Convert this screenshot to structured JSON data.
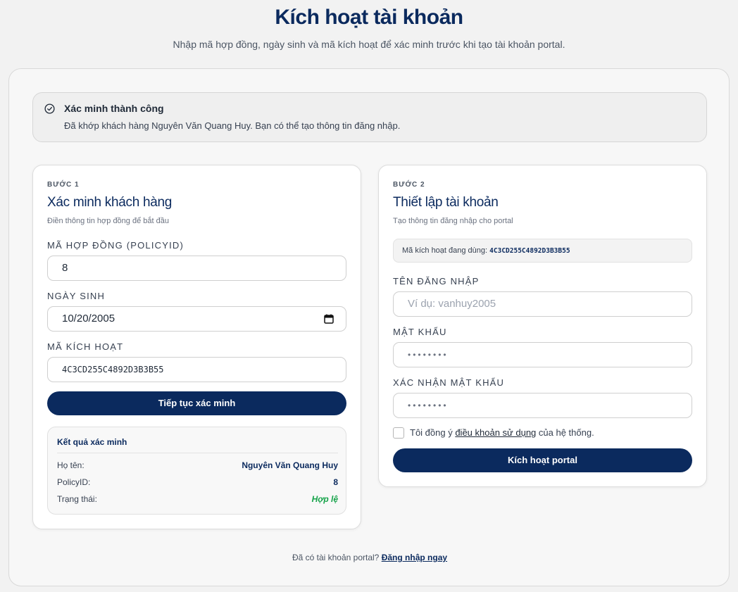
{
  "header": {
    "title": "Kích hoạt tài khoản",
    "subtitle": "Nhập mã hợp đồng, ngày sinh và mã kích hoạt để xác minh trước khi tạo tài khoản portal."
  },
  "alert": {
    "icon": "check-circle-icon",
    "title": "Xác minh thành công",
    "text": "Đã khớp khách hàng Nguyên Văn Quang Huy. Bạn có thể tạo thông tin đăng nhập."
  },
  "step1": {
    "label": "BƯỚC 1",
    "title": "Xác minh khách hàng",
    "description": "Điền thông tin hợp đồng để bắt đầu",
    "policy_label": "MÃ HỢP ĐỒNG (POLICYID)",
    "policy_value": "8",
    "dob_label": "NGÀY SINH",
    "dob_value": "10/20/2005",
    "code_label": "MÃ KÍCH HOẠT",
    "code_value": "4C3CD255C4892D3B3B55",
    "submit_label": "Tiếp tục xác minh",
    "result": {
      "title": "Kết quả xác minh",
      "rows": [
        {
          "key": "Họ tên:",
          "value": "Nguyên Văn Quang Huy"
        },
        {
          "key": "PolicyID:",
          "value": "8"
        },
        {
          "key": "Trạng thái:",
          "value": "Hợp lệ"
        }
      ]
    }
  },
  "step2": {
    "label": "BƯỚC 2",
    "title": "Thiết lập tài khoản",
    "description": "Tạo thông tin đăng nhập cho portal",
    "code_in_use_label": "Mã kích hoạt đang dùng:",
    "code_in_use_value": "4C3CD255C4892D3B3B55",
    "username_label": "TÊN ĐĂNG NHẬP",
    "username_placeholder": "Ví dụ: vanhuy2005",
    "password_label": "MẬT KHẨU",
    "password_value": "••••••••",
    "confirm_label": "XÁC NHẬN MẬT KHẨU",
    "confirm_value": "••••••••",
    "terms_prefix": "Tôi đồng ý ",
    "terms_link": "điều khoản sử dụng",
    "terms_suffix": " của hệ thống.",
    "submit_label": "Kích hoạt portal"
  },
  "footer": {
    "text": "Đã có tài khoản portal?",
    "link": "Đăng nhập ngay"
  },
  "colors": {
    "primary": "#0b2a5e",
    "success": "#16a34a"
  }
}
